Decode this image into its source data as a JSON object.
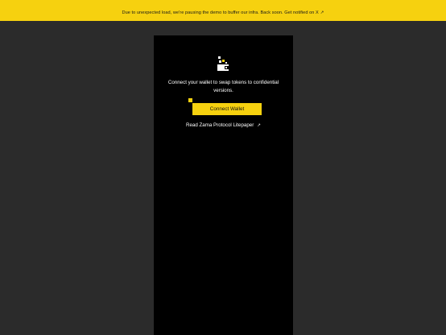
{
  "banner": {
    "message": "Due to unexpected load, we're pausing the demo to buffer our infra. Back soon. Get notified on X",
    "arrow_icon": "external-arrow-icon"
  },
  "panel": {
    "icon": "wallet-icon",
    "connect_line1": "Connect your wallet to swap tokens to confidential",
    "connect_line2": "versions.",
    "connect_button_label": "Connect Wallet",
    "litepaper_label": "Read Zama Protocol Litepaper",
    "litepaper_arrow_icon": "external-arrow-icon"
  },
  "colors": {
    "accent_yellow": "#f6d10f",
    "page_background": "#2b2b2b",
    "panel_background": "#000000"
  }
}
